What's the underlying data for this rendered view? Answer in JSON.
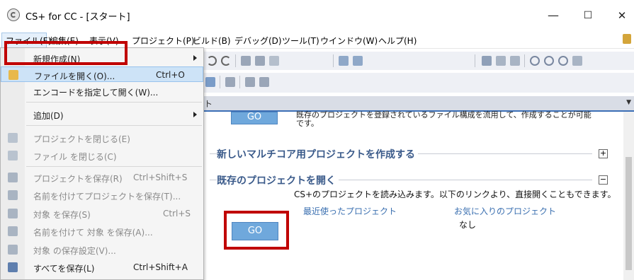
{
  "window": {
    "title": "CS+ for CC - [スタート]",
    "minimize": "—",
    "maximize": "☐",
    "close": "✕"
  },
  "menubar": {
    "items": [
      {
        "label": "ファイル(F)"
      },
      {
        "label": "編集(E)"
      },
      {
        "label": "表示(V)"
      },
      {
        "label": "プロジェクト(P)"
      },
      {
        "label": "ビルド(B)"
      },
      {
        "label": "デバッグ(D)"
      },
      {
        "label": "ツール(T)"
      },
      {
        "label": "ウインドウ(W)"
      },
      {
        "label": "ヘルプ(H)"
      }
    ]
  },
  "file_menu": {
    "items": [
      {
        "label": "新規作成(N)",
        "shortcut": "",
        "submenu": true,
        "enabled": true
      },
      {
        "label": "ファイルを開く(O)...",
        "shortcut": "Ctrl+O",
        "submenu": false,
        "enabled": true
      },
      {
        "label": "エンコードを指定して開く(W)...",
        "shortcut": "",
        "submenu": false,
        "enabled": true
      },
      {
        "label": "追加(D)",
        "shortcut": "",
        "submenu": true,
        "enabled": true
      },
      {
        "label": "プロジェクトを閉じる(E)",
        "shortcut": "",
        "submenu": false,
        "enabled": false
      },
      {
        "label": "ファイル を閉じる(C)",
        "shortcut": "",
        "submenu": false,
        "enabled": false
      },
      {
        "label": "プロジェクトを保存(R)",
        "shortcut": "Ctrl+Shift+S",
        "submenu": false,
        "enabled": false
      },
      {
        "label": "名前を付けてプロジェクトを保存(T)...",
        "shortcut": "",
        "submenu": false,
        "enabled": false
      },
      {
        "label": "対象 を保存(S)",
        "shortcut": "Ctrl+S",
        "submenu": false,
        "enabled": false
      },
      {
        "label": "名前を付けて 対象 を保存(A)...",
        "shortcut": "",
        "submenu": false,
        "enabled": false
      },
      {
        "label": "対象 の保存設定(V)...",
        "shortcut": "",
        "submenu": false,
        "enabled": false
      },
      {
        "label": "すべてを保存(L)",
        "shortcut": "Ctrl+Shift+A",
        "submenu": false,
        "enabled": true
      }
    ]
  },
  "tab": {
    "label": "ト"
  },
  "content": {
    "go_label": "GO",
    "top_desc": "既存のプロジェクトを登録されているファイル構成を流用して、作成することが可能です。",
    "new_multicore_title": "新しいマルチコア用プロジェクトを作成する",
    "open_existing_title": "既存のプロジェクトを開く",
    "open_existing_desc": "CS+のプロジェクトを読み込みます。以下のリンクより、直接開くこともできます。",
    "recent_projects_link": "最近使ったプロジェクト",
    "favorite_projects_link": "お気に入りのプロジェクト",
    "favorites_none": "なし",
    "expand_sign": "+",
    "collapse_sign": "−"
  },
  "colors": {
    "highlight_box": "#c00000",
    "go_button": "#6fa8dc",
    "section_title": "#3a5a8a",
    "menu_highlight": "#cde3f7"
  }
}
